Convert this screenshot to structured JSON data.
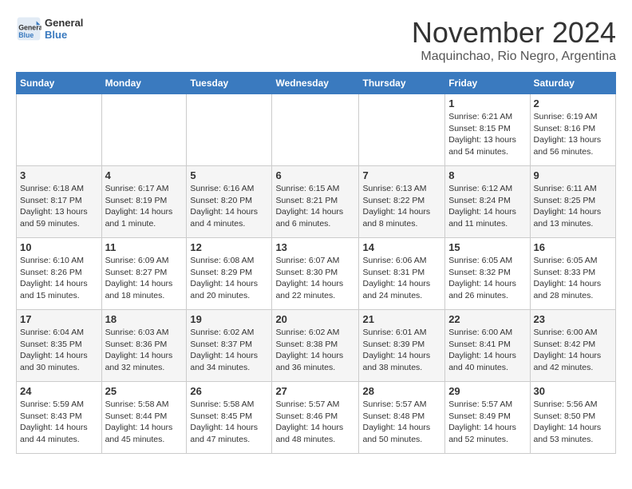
{
  "logo": {
    "line1": "General",
    "line2": "Blue"
  },
  "title": "November 2024",
  "subtitle": "Maquinchao, Rio Negro, Argentina",
  "days_of_week": [
    "Sunday",
    "Monday",
    "Tuesday",
    "Wednesday",
    "Thursday",
    "Friday",
    "Saturday"
  ],
  "weeks": [
    [
      {
        "day": "",
        "info": ""
      },
      {
        "day": "",
        "info": ""
      },
      {
        "day": "",
        "info": ""
      },
      {
        "day": "",
        "info": ""
      },
      {
        "day": "",
        "info": ""
      },
      {
        "day": "1",
        "info": "Sunrise: 6:21 AM\nSunset: 8:15 PM\nDaylight: 13 hours\nand 54 minutes."
      },
      {
        "day": "2",
        "info": "Sunrise: 6:19 AM\nSunset: 8:16 PM\nDaylight: 13 hours\nand 56 minutes."
      }
    ],
    [
      {
        "day": "3",
        "info": "Sunrise: 6:18 AM\nSunset: 8:17 PM\nDaylight: 13 hours\nand 59 minutes."
      },
      {
        "day": "4",
        "info": "Sunrise: 6:17 AM\nSunset: 8:19 PM\nDaylight: 14 hours\nand 1 minute."
      },
      {
        "day": "5",
        "info": "Sunrise: 6:16 AM\nSunset: 8:20 PM\nDaylight: 14 hours\nand 4 minutes."
      },
      {
        "day": "6",
        "info": "Sunrise: 6:15 AM\nSunset: 8:21 PM\nDaylight: 14 hours\nand 6 minutes."
      },
      {
        "day": "7",
        "info": "Sunrise: 6:13 AM\nSunset: 8:22 PM\nDaylight: 14 hours\nand 8 minutes."
      },
      {
        "day": "8",
        "info": "Sunrise: 6:12 AM\nSunset: 8:24 PM\nDaylight: 14 hours\nand 11 minutes."
      },
      {
        "day": "9",
        "info": "Sunrise: 6:11 AM\nSunset: 8:25 PM\nDaylight: 14 hours\nand 13 minutes."
      }
    ],
    [
      {
        "day": "10",
        "info": "Sunrise: 6:10 AM\nSunset: 8:26 PM\nDaylight: 14 hours\nand 15 minutes."
      },
      {
        "day": "11",
        "info": "Sunrise: 6:09 AM\nSunset: 8:27 PM\nDaylight: 14 hours\nand 18 minutes."
      },
      {
        "day": "12",
        "info": "Sunrise: 6:08 AM\nSunset: 8:29 PM\nDaylight: 14 hours\nand 20 minutes."
      },
      {
        "day": "13",
        "info": "Sunrise: 6:07 AM\nSunset: 8:30 PM\nDaylight: 14 hours\nand 22 minutes."
      },
      {
        "day": "14",
        "info": "Sunrise: 6:06 AM\nSunset: 8:31 PM\nDaylight: 14 hours\nand 24 minutes."
      },
      {
        "day": "15",
        "info": "Sunrise: 6:05 AM\nSunset: 8:32 PM\nDaylight: 14 hours\nand 26 minutes."
      },
      {
        "day": "16",
        "info": "Sunrise: 6:05 AM\nSunset: 8:33 PM\nDaylight: 14 hours\nand 28 minutes."
      }
    ],
    [
      {
        "day": "17",
        "info": "Sunrise: 6:04 AM\nSunset: 8:35 PM\nDaylight: 14 hours\nand 30 minutes."
      },
      {
        "day": "18",
        "info": "Sunrise: 6:03 AM\nSunset: 8:36 PM\nDaylight: 14 hours\nand 32 minutes."
      },
      {
        "day": "19",
        "info": "Sunrise: 6:02 AM\nSunset: 8:37 PM\nDaylight: 14 hours\nand 34 minutes."
      },
      {
        "day": "20",
        "info": "Sunrise: 6:02 AM\nSunset: 8:38 PM\nDaylight: 14 hours\nand 36 minutes."
      },
      {
        "day": "21",
        "info": "Sunrise: 6:01 AM\nSunset: 8:39 PM\nDaylight: 14 hours\nand 38 minutes."
      },
      {
        "day": "22",
        "info": "Sunrise: 6:00 AM\nSunset: 8:41 PM\nDaylight: 14 hours\nand 40 minutes."
      },
      {
        "day": "23",
        "info": "Sunrise: 6:00 AM\nSunset: 8:42 PM\nDaylight: 14 hours\nand 42 minutes."
      }
    ],
    [
      {
        "day": "24",
        "info": "Sunrise: 5:59 AM\nSunset: 8:43 PM\nDaylight: 14 hours\nand 44 minutes."
      },
      {
        "day": "25",
        "info": "Sunrise: 5:58 AM\nSunset: 8:44 PM\nDaylight: 14 hours\nand 45 minutes."
      },
      {
        "day": "26",
        "info": "Sunrise: 5:58 AM\nSunset: 8:45 PM\nDaylight: 14 hours\nand 47 minutes."
      },
      {
        "day": "27",
        "info": "Sunrise: 5:57 AM\nSunset: 8:46 PM\nDaylight: 14 hours\nand 48 minutes."
      },
      {
        "day": "28",
        "info": "Sunrise: 5:57 AM\nSunset: 8:48 PM\nDaylight: 14 hours\nand 50 minutes."
      },
      {
        "day": "29",
        "info": "Sunrise: 5:57 AM\nSunset: 8:49 PM\nDaylight: 14 hours\nand 52 minutes."
      },
      {
        "day": "30",
        "info": "Sunrise: 5:56 AM\nSunset: 8:50 PM\nDaylight: 14 hours\nand 53 minutes."
      }
    ]
  ]
}
